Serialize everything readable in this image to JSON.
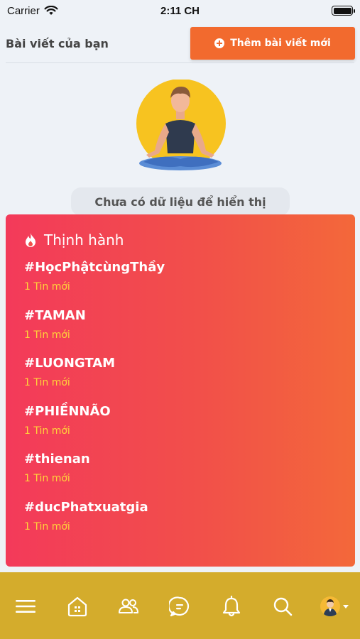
{
  "status_bar": {
    "carrier": "Carrier",
    "time": "2:11 CH"
  },
  "header": {
    "title": "Bài viết của bạn",
    "add_button_label": "Thêm bài viết mới"
  },
  "empty_state": {
    "message": "Chưa có dữ liệu để hiển thị",
    "illustration": "meditation-person"
  },
  "trending": {
    "title": "Thịnh hành",
    "items": [
      {
        "tag": "#HọcPhậtcùngThầy",
        "count": "1 Tin mới"
      },
      {
        "tag": "#TAMAN",
        "count": "1 Tin mới"
      },
      {
        "tag": "#LUONGTAM",
        "count": "1 Tin mới"
      },
      {
        "tag": "#PHIỀNNÃO",
        "count": "1 Tin mới"
      },
      {
        "tag": "#thienan",
        "count": "1 Tin mới"
      },
      {
        "tag": "#ducPhatxuatgia",
        "count": "1 Tin mới"
      }
    ]
  },
  "bottom_nav": {
    "items": [
      "menu-icon",
      "home-icon",
      "users-icon",
      "chat-icon",
      "bell-icon",
      "search-icon",
      "avatar"
    ]
  },
  "colors": {
    "accent": "#f26a2e",
    "trending_start": "#f33a5a",
    "trending_end": "#f3683a",
    "highlight": "#ffd43a",
    "bottom_bar": "#d4ac2c"
  }
}
